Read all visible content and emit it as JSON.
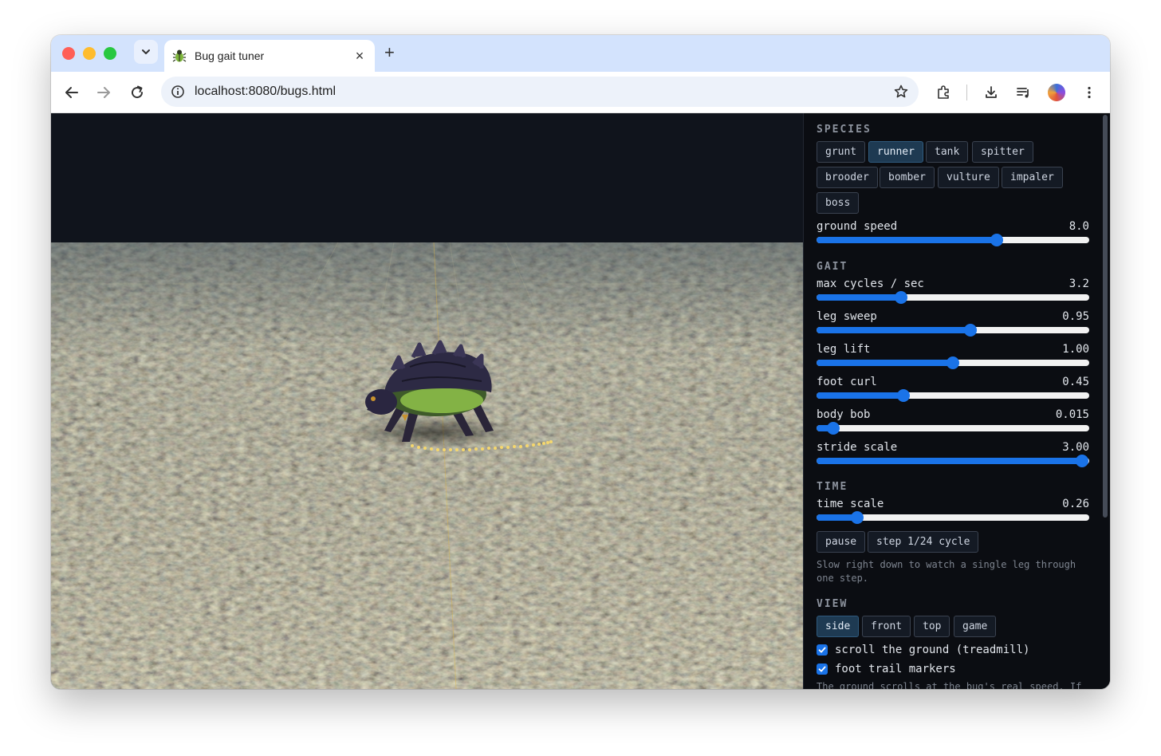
{
  "browser": {
    "tab_title": "Bug gait tuner",
    "url": "localhost:8080/bugs.html",
    "new_tab_label": "+",
    "close_tab_label": "×"
  },
  "panel": {
    "species": {
      "heading": "SPECIES",
      "options": [
        "grunt",
        "runner",
        "tank",
        "spitter",
        "brooder",
        "bomber",
        "vulture",
        "impaler",
        "boss"
      ],
      "selected": "runner",
      "ground_speed": {
        "label": "ground speed",
        "value": "8.0",
        "fraction": 0.66
      }
    },
    "gait": {
      "heading": "GAIT",
      "sliders": [
        {
          "label": "max cycles / sec",
          "value": "3.2",
          "fraction": 0.31
        },
        {
          "label": "leg sweep",
          "value": "0.95",
          "fraction": 0.565
        },
        {
          "label": "leg lift",
          "value": "1.00",
          "fraction": 0.5
        },
        {
          "label": "foot curl",
          "value": "0.45",
          "fraction": 0.32
        },
        {
          "label": "body bob",
          "value": "0.015",
          "fraction": 0.06
        },
        {
          "label": "stride scale",
          "value": "3.00",
          "fraction": 0.975
        }
      ]
    },
    "time": {
      "heading": "TIME",
      "time_scale": {
        "label": "time scale",
        "value": "0.26",
        "fraction": 0.15
      },
      "pause_label": "pause",
      "step_label": "step 1/24 cycle",
      "note": "Slow right down to watch a single leg through one step."
    },
    "view": {
      "heading": "VIEW",
      "options": [
        "side",
        "front",
        "top",
        "game"
      ],
      "selected": "side",
      "scroll_ground": {
        "label": "scroll the ground (treadmill)",
        "checked": true
      },
      "foot_trail": {
        "label": "foot trail markers",
        "checked": true
      },
      "note": "The ground scrolls at the bug's real speed. If"
    }
  },
  "colors": {
    "accent": "#1a73e8",
    "panel_bg": "#0b0d12",
    "chip_active": "#1e3a52",
    "trail": "#f5d76e"
  }
}
